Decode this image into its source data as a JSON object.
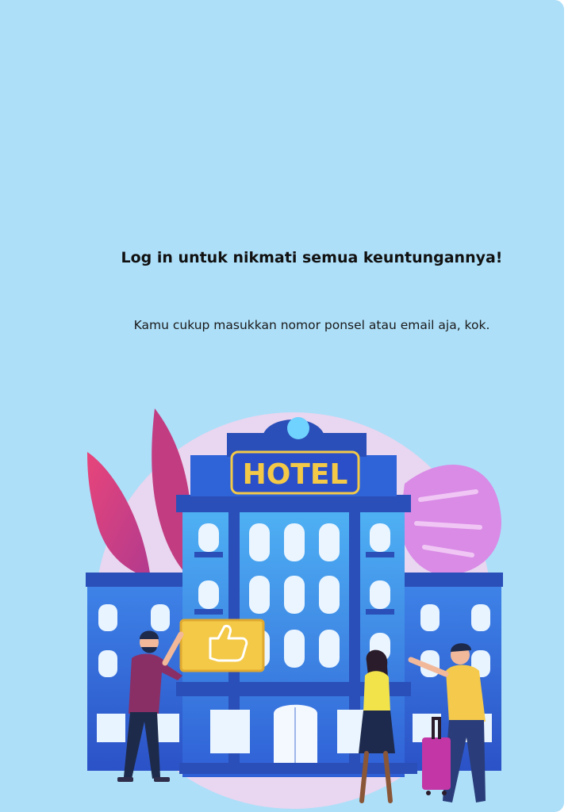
{
  "login_panel": {
    "heading": "Log in untuk nikmati semua keuntungannya!",
    "subtitle": "Kamu cukup masukkan nomor ponsel atau email aja, kok.",
    "illustration": {
      "sign_text": "HOTEL",
      "icons": [
        "hotel-illustration",
        "thumbs-up-icon",
        "suitcase-icon"
      ]
    }
  },
  "colors": {
    "background": "#addff9",
    "building": "#3f7ee8",
    "sign": "#f3c947",
    "leaf_pink": "#d9457a",
    "leaf_monstera": "#d98be6"
  }
}
